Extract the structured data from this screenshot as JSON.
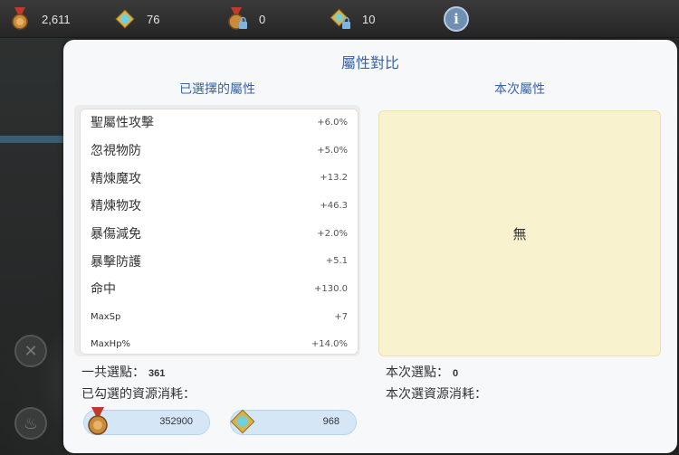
{
  "topbar": {
    "currencies": [
      {
        "icon": "medal-icon",
        "value": "2,611"
      },
      {
        "icon": "crystal-gear-icon",
        "value": "76"
      },
      {
        "icon": "locked-medal-icon",
        "value": "0"
      },
      {
        "icon": "locked-crystal-icon",
        "value": "10"
      }
    ],
    "info_label": "i"
  },
  "modal": {
    "title": "屬性對比",
    "left_title": "已選擇的屬性",
    "right_title": "本次屬性",
    "selected_attributes": [
      {
        "name": "聖屬性攻擊",
        "value": "+6.0%"
      },
      {
        "name": "忽視物防",
        "value": "+5.0%"
      },
      {
        "name": "精煉魔攻",
        "value": "+13.2"
      },
      {
        "name": "精煉物攻",
        "value": "+46.3"
      },
      {
        "name": "暴傷減免",
        "value": "+2.0%"
      },
      {
        "name": "暴擊防護",
        "value": "+5.1"
      },
      {
        "name": "命中",
        "value": "+130.0"
      },
      {
        "name": "MaxSp",
        "value": "+7"
      },
      {
        "name": "MaxHp%",
        "value": "+14.0%"
      }
    ],
    "current_attributes_empty": "無",
    "left_stats": {
      "total_points_label": "一共選點：",
      "total_points_value": "361",
      "checked_cost_label": "已勾選的資源消耗："
    },
    "right_stats": {
      "points_label": "本次選點：",
      "points_value": "0",
      "cost_label": "本次選資源消耗："
    },
    "costs": [
      {
        "icon": "medal-icon",
        "value": "352900"
      },
      {
        "icon": "crystal-gear-icon",
        "value": "968"
      }
    ]
  },
  "colors": {
    "accent": "#3a63a8",
    "empty_panel": "#f9f2cf",
    "pill": "#d5e7f7"
  }
}
